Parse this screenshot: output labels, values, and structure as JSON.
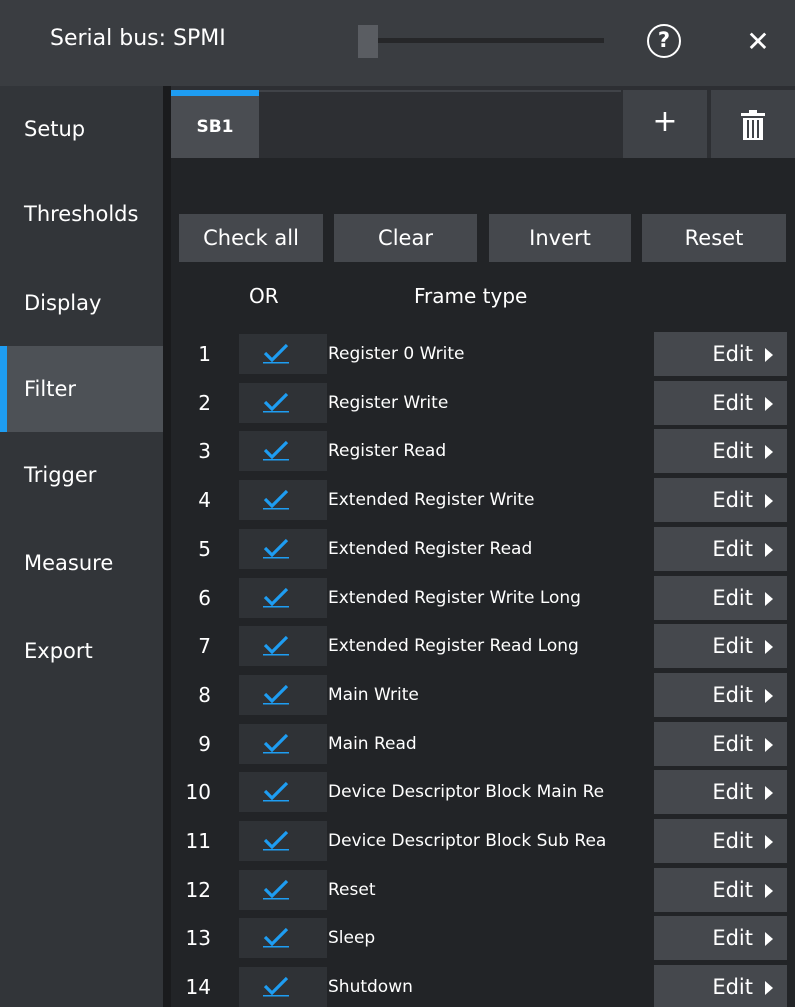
{
  "window": {
    "title": "Serial bus: SPMI",
    "help_glyph": "?",
    "close_glyph": "✕"
  },
  "sidebar": {
    "items": [
      {
        "label": "Setup"
      },
      {
        "label": "Thresholds"
      },
      {
        "label": "Display"
      },
      {
        "label": "Filter",
        "active": true
      },
      {
        "label": "Trigger"
      },
      {
        "label": "Measure"
      },
      {
        "label": "Export"
      }
    ]
  },
  "tabs": {
    "active_label": "SB1",
    "add_glyph": "+"
  },
  "actions": {
    "check_all": "Check all",
    "clear": "Clear",
    "invert": "Invert",
    "reset": "Reset"
  },
  "table": {
    "col_or": "OR",
    "col_frame_type": "Frame type",
    "edit_label": "Edit",
    "rows": [
      {
        "num": "1",
        "checked": true,
        "label": "Register 0 Write"
      },
      {
        "num": "2",
        "checked": true,
        "label": "Register Write"
      },
      {
        "num": "3",
        "checked": true,
        "label": "Register Read"
      },
      {
        "num": "4",
        "checked": true,
        "label": "Extended Register Write"
      },
      {
        "num": "5",
        "checked": true,
        "label": "Extended Register Read"
      },
      {
        "num": "6",
        "checked": true,
        "label": "Extended Register Write Long"
      },
      {
        "num": "7",
        "checked": true,
        "label": "Extended Register Read Long"
      },
      {
        "num": "8",
        "checked": true,
        "label": "Main Write"
      },
      {
        "num": "9",
        "checked": true,
        "label": "Main Read"
      },
      {
        "num": "10",
        "checked": true,
        "label": "Device Descriptor Block Main Re"
      },
      {
        "num": "11",
        "checked": true,
        "label": "Device Descriptor Block Sub Rea"
      },
      {
        "num": "12",
        "checked": true,
        "label": "Reset"
      },
      {
        "num": "13",
        "checked": true,
        "label": "Sleep"
      },
      {
        "num": "14",
        "checked": true,
        "label": "Shutdown"
      }
    ]
  },
  "colors": {
    "accent": "#1e9df2",
    "background": "#222427",
    "button": "#45484d"
  }
}
